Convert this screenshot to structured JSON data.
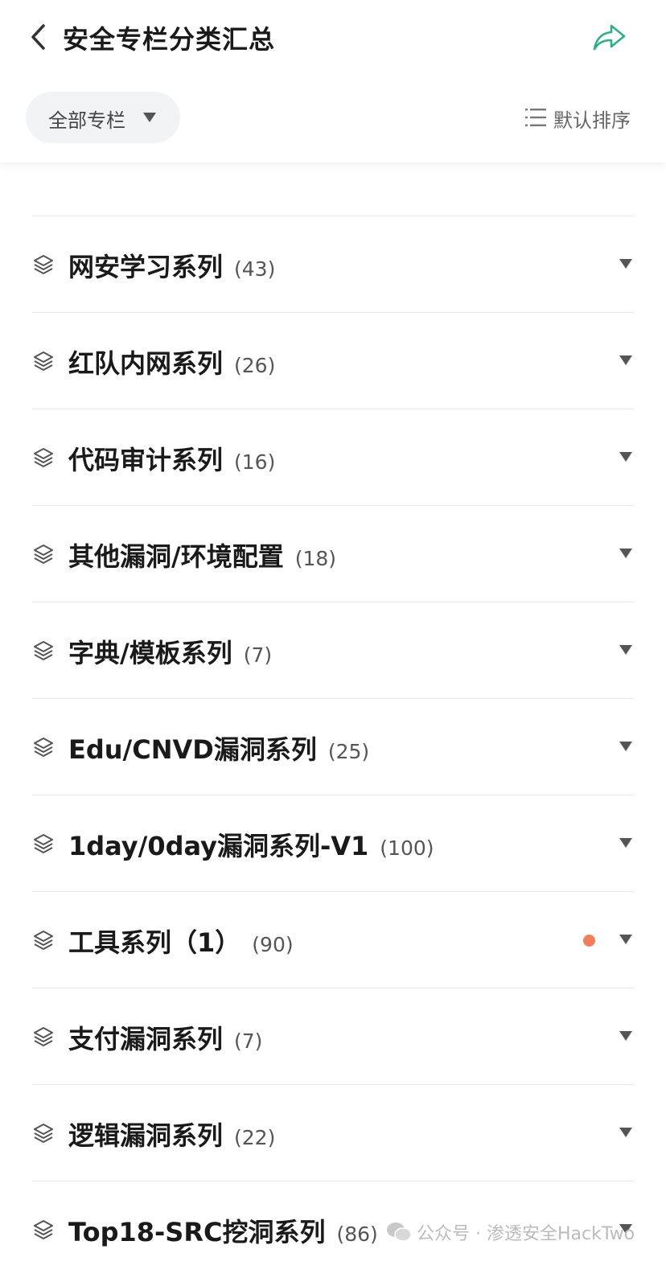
{
  "header": {
    "title": "安全专栏分类汇总",
    "filter_label": "全部专栏",
    "sort_label": "默认排序"
  },
  "colors": {
    "accent": "#2aae8c",
    "unread_dot": "#f0805a",
    "divider": "#e8e8e8"
  },
  "rows": [
    {
      "title": "网安学习系列",
      "count": "(43)",
      "unread": false
    },
    {
      "title": "红队内网系列",
      "count": "(26)",
      "unread": false
    },
    {
      "title": "代码审计系列",
      "count": "(16)",
      "unread": false
    },
    {
      "title": "其他漏洞/环境配置",
      "count": "(18)",
      "unread": false
    },
    {
      "title": "字典/模板系列",
      "count": "(7)",
      "unread": false
    },
    {
      "title": "Edu/CNVD漏洞系列",
      "count": "(25)",
      "unread": false
    },
    {
      "title": "1day/0day漏洞系列-V1",
      "count": "(100)",
      "unread": false
    },
    {
      "title": "工具系列（1）",
      "count": "(90)",
      "unread": true
    },
    {
      "title": "支付漏洞系列",
      "count": "(7)",
      "unread": false
    },
    {
      "title": "逻辑漏洞系列",
      "count": "(22)",
      "unread": false
    },
    {
      "title": "Top18-SRC挖洞系列",
      "count": "(86)",
      "unread": false
    }
  ],
  "watermark": "公众号 · 渗透安全HackTwo"
}
